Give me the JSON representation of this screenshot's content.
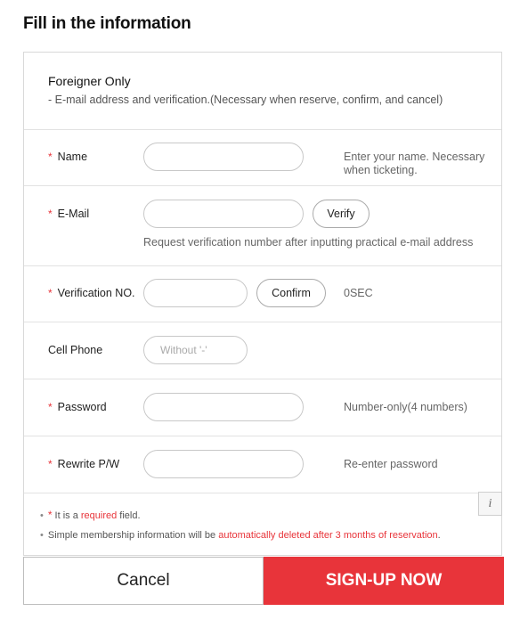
{
  "page_title": "Fill in the information",
  "intro": {
    "title": "Foreigner Only",
    "description": "- E-mail address and verification.(Necessary when reserve, confirm, and cancel)"
  },
  "required_mark": "*",
  "fields": {
    "name": {
      "label": "Name",
      "value": "",
      "hint": "Enter your name. Necessary when ticketing."
    },
    "email": {
      "label": "E-Mail",
      "value": "",
      "button": "Verify",
      "hint": "Request verification number after inputting practical e-mail address"
    },
    "verification": {
      "label": "Verification NO.",
      "value": "",
      "button": "Confirm",
      "timer": "0SEC"
    },
    "cell_phone": {
      "label": "Cell Phone",
      "placeholder": "Without '-'"
    },
    "password": {
      "label": "Password",
      "value": "",
      "hint": "Number-only(4 numbers)"
    },
    "rewrite_password": {
      "label": "Rewrite P/W",
      "value": "",
      "hint": "Re-enter password"
    }
  },
  "notes": {
    "required_prefix": "It is a ",
    "required_word": "required",
    "required_suffix": " field.",
    "membership_prefix": "Simple membership information will be ",
    "membership_highlight": "automatically deleted after 3 months of reservation",
    "membership_suffix": ".",
    "info_button": "i"
  },
  "buttons": {
    "cancel": "Cancel",
    "signup": "SIGN-UP NOW"
  },
  "colors": {
    "accent": "#e8343a",
    "border": "#d9d9d9"
  }
}
